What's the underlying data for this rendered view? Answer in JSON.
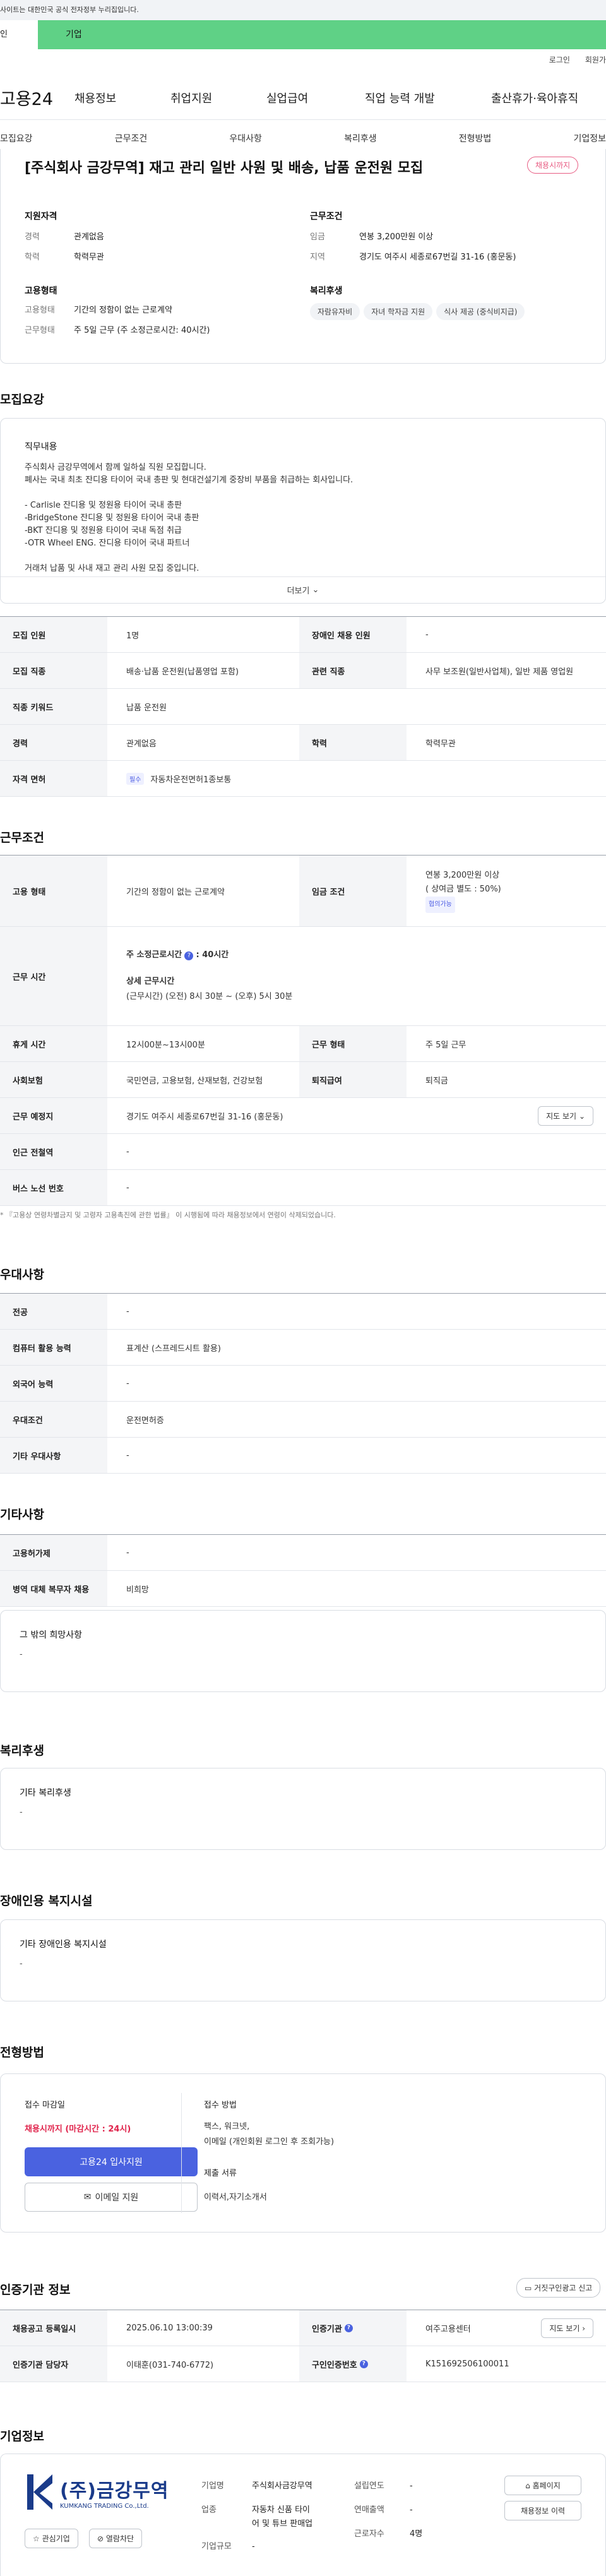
{
  "gov": {
    "notice": "사이트는 대한민국 공식 전자정부 누리집입니다."
  },
  "user_tabs": {
    "personal": "인",
    "company": "기업"
  },
  "util": {
    "login": "로그인",
    "join": "회원가"
  },
  "gnb": {
    "logo": "고용24",
    "menu": [
      "채용정보",
      "취업지원",
      "실업급여",
      "직업 능력 개발",
      "출산휴가·육아휴직"
    ]
  },
  "subnav": [
    "모집요강",
    "근무조건",
    "우대사항",
    "복리후생",
    "전형방법",
    "기업정보"
  ],
  "summary": {
    "title": "[주식회사 금강무역] 재고 관리 일반 사원 및 배송, 납품 운전원 모집",
    "badge": "채용시까지",
    "qual": {
      "heading": "지원자격",
      "career_k": "경력",
      "career_v": "관계없음",
      "edu_k": "학력",
      "edu_v": "학력무관"
    },
    "cond": {
      "heading": "근무조건",
      "wage_k": "임금",
      "wage_v": "연봉 3,200만원 이상",
      "area_k": "지역",
      "area_v": "경기도 여주시 세종로67번길 31-16 (홍문동)"
    },
    "emp": {
      "heading": "고용형태",
      "type_k": "고용형태",
      "type_v": "기간의 정함이 없는 근로계약",
      "form_k": "근무형태",
      "form_v": "주 5일 근무 (주 소정근로시간: 40시간)"
    },
    "welfare": {
      "heading": "복리후생",
      "tags": [
        "자람유자비",
        "자녀 학자금 지원",
        "식사 제공 (중식비지급)"
      ]
    }
  },
  "recruit": {
    "section": "모집요강",
    "job_heading": "직무내용",
    "lines": [
      "주식회사 금강무역에서 함께 일하실 직원 모집합니다.",
      "폐사는 국내 최초 잔디용 타이어 국내 총판 및 현대건설기계 중장비 부품을 취급하는 회사입니다.",
      "",
      "- Carlisle 잔디용 및 정원용 타이어 국내 총판",
      "-BridgeStone 잔디용 및 정원용 타이어 국내 총판",
      "-BKT 잔디용 및 정원용 타이어 국내 독점 취급",
      "-OTR Wheel ENG. 잔디용 타이어 국내 파트너",
      "",
      "거래처 납품 및 사내 재고 관리 사원 모집 중입니다."
    ],
    "more": "더보기",
    "t": {
      "count_k": "모집 인원",
      "count_v": "1명",
      "disabled_k": "장애인 채용 인원",
      "disabled_v": "-",
      "job_k": "모집 직종",
      "job_v": "배송·납품 운전원(납품영업 포함)",
      "rel_k": "관련 직종",
      "rel_v": "사무 보조원(일반사업체), 일반 제품 영업원",
      "kw_k": "직종 키워드",
      "kw_v": "납품 운전원",
      "career_k": "경력",
      "career_v": "관계없음",
      "edu_k": "학력",
      "edu_v": "학력무관",
      "lic_k": "자격 면허",
      "lic_badge": "필수",
      "lic_v": "자동차운전면허1종보통"
    }
  },
  "work": {
    "section": "근무조건",
    "emp_k": "고용 형태",
    "emp_v": "기간의 정함이 없는 근로계약",
    "wage_k": "임금 조건",
    "wage_v": "연봉 3,200만원 이상",
    "wage_v2": "( 상여금 별도 : 50%)",
    "wage_tag": "협의가능",
    "time_k": "근무 시간",
    "time_week": "주 소정근로시간",
    "time_week_v": ": 40시간",
    "time_detail": "상세 근무시간",
    "time_detail_v": "(근무시간) (오전) 8시 30분 ~ (오후) 5시 30분",
    "rest_k": "휴게 시간",
    "rest_v": "12시00분~13시00분",
    "form_k": "근무 형태",
    "form_v": "주 5일 근무",
    "ins_k": "사회보험",
    "ins_v": "국민연금, 고용보험, 산재보험, 건강보험",
    "sev_k": "퇴직급여",
    "sev_v": "퇴직금",
    "place_k": "근무 예정지",
    "place_v": "경기도 여주시 세종로67번길 31-16 (홍문동)",
    "map": "지도 보기",
    "sub_k": "인근 전철역",
    "sub_v": "-",
    "bus_k": "버스 노선 번호",
    "bus_v": "-",
    "note": "* 『고용상 연령차별금지 및 고령자 고용촉진에 관한 법률』 이 시행됨에 따라 채용정보에서 연령이 삭제되었습니다."
  },
  "pref": {
    "section": "우대사항",
    "major_k": "전공",
    "major_v": "-",
    "pc_k": "컴퓨터 활용 능력",
    "pc_v": "표계산 (스프레드시트 활용)",
    "lang_k": "외국어 능력",
    "lang_v": "-",
    "cond_k": "우대조건",
    "cond_v": "운전면허증",
    "etc_k": "기타 우대사항",
    "etc_v": "-"
  },
  "other": {
    "section": "기타사항",
    "hire_k": "고용허가제",
    "hire_v": "-",
    "mil_k": "병역 대체 복무자 채용",
    "mil_v": "비희망",
    "wish_title": "그 밖의 희망사항",
    "wish_v": "-"
  },
  "welfare": {
    "section": "복리후생",
    "title": "기타 복리후생",
    "v": "-"
  },
  "disab": {
    "section": "장애인용 복지시설",
    "title": "기타 장애인용 복지시설",
    "v": "-"
  },
  "process": {
    "section": "전형방법",
    "deadline_k": "접수 마감일",
    "deadline_v": "채용시까지 (마감시간 : 24시)",
    "apply": "고용24 입사지원",
    "email": "이메일 지원",
    "method_k": "접수 방법",
    "method_v": "팩스, 워크넷,",
    "method_v2": "이메일 (개인회원 로그인 후 조회가능)",
    "docs_k": "제출 서류",
    "docs_v": "이력서,자기소개서"
  },
  "cert": {
    "section": "인증기관 정보",
    "report": "거짓구인광고 신고",
    "reg_k": "채용공고 등록일시",
    "reg_v": "2025.06.10 13:00:39",
    "org_k": "인증기관",
    "org_v": "여주고용센터",
    "map": "지도 보기",
    "mgr_k": "인증기관 담당자",
    "mgr_v": "이태훈(031-740-6772)",
    "no_k": "구인인증번호",
    "no_v": "K151692506100011"
  },
  "company": {
    "section": "기업정보",
    "logo_ko": "(주)금강무역",
    "logo_en": "KUMKANG TRADING Co.,Ltd.",
    "fav": "관심기업",
    "block": "열람차단",
    "name_k": "기업명",
    "name_v": "주식회사금강무역",
    "biz_k": "업종",
    "biz_v": "자동차 신품 타이",
    "biz_v2": "어 및 튜브 판매업",
    "size_k": "기업규모",
    "size_v": "-",
    "est_k": "설립연도",
    "est_v": "-",
    "rev_k": "연매출액",
    "rev_v": "-",
    "emp_k": "근로자수",
    "emp_v": "4명",
    "home": "홈페이지",
    "jobs": "채용정보 이력"
  },
  "colors": {
    "brand_green": "#5fd186",
    "primary_blue": "#4a62e0",
    "badge_pink": "#e85c83",
    "alert_red": "#e0244c"
  }
}
